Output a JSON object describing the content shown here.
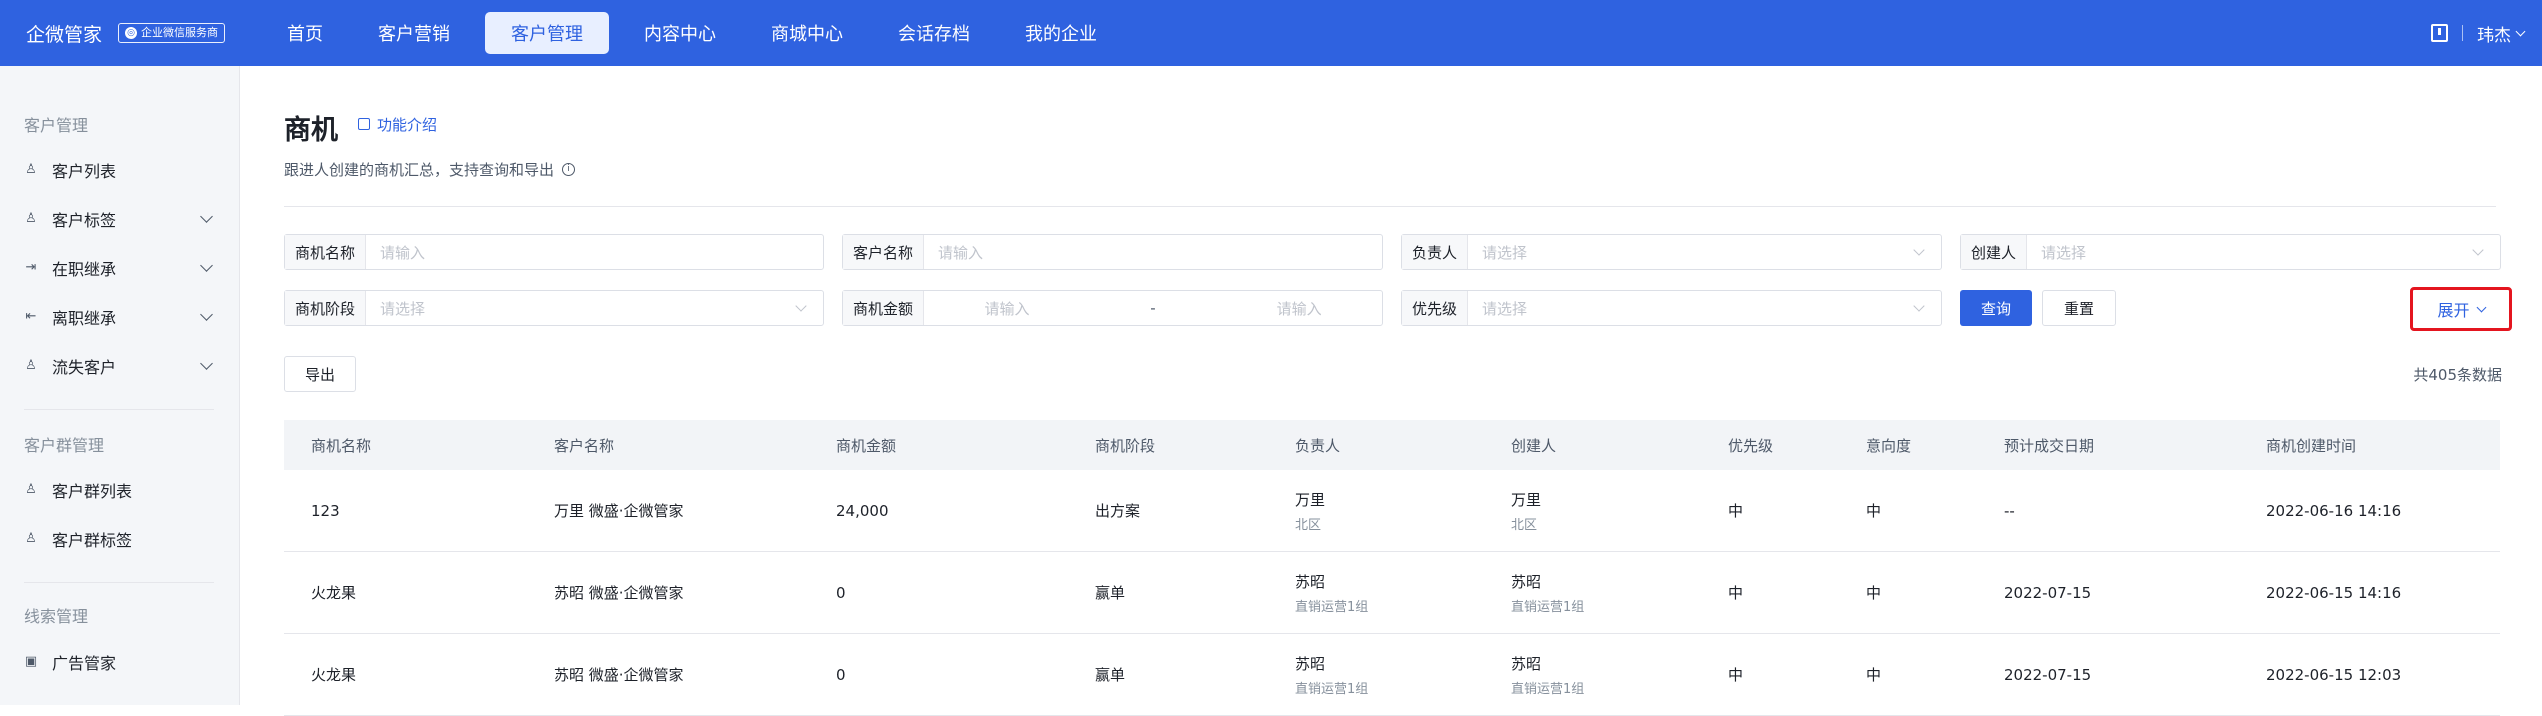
{
  "header": {
    "brand": "企微管家",
    "brand_badge": "企业微信服务商",
    "nav": [
      "首页",
      "客户营销",
      "客户管理",
      "内容中心",
      "商城中心",
      "会话存档",
      "我的企业"
    ],
    "active_nav": "客户管理",
    "user": "玮杰"
  },
  "sidebar": {
    "groups": [
      {
        "title": "客户管理",
        "items": [
          {
            "label": "客户列表",
            "icon": "user-icon",
            "expandable": false
          },
          {
            "label": "客户标签",
            "icon": "user-tag-icon",
            "expandable": true
          },
          {
            "label": "在职继承",
            "icon": "transfer-in-icon",
            "expandable": true
          },
          {
            "label": "离职继承",
            "icon": "transfer-out-icon",
            "expandable": true
          },
          {
            "label": "流失客户",
            "icon": "user-lost-icon",
            "expandable": true
          }
        ]
      },
      {
        "title": "客户群管理",
        "items": [
          {
            "label": "客户群列表",
            "icon": "group-icon",
            "expandable": false
          },
          {
            "label": "客户群标签",
            "icon": "group-tag-icon",
            "expandable": false
          }
        ]
      },
      {
        "title": "线索管理",
        "items": [
          {
            "label": "广告管家",
            "icon": "ad-icon",
            "expandable": false
          }
        ]
      }
    ]
  },
  "page": {
    "title": "商机",
    "intro_link": "功能介绍",
    "subtitle": "跟进人创建的商机汇总，支持查询和导出"
  },
  "filters": {
    "name": {
      "label": "商机名称",
      "placeholder": "请输入"
    },
    "customer": {
      "label": "客户名称",
      "placeholder": "请输入"
    },
    "owner": {
      "label": "负责人",
      "placeholder": "请选择"
    },
    "creator": {
      "label": "创建人",
      "placeholder": "请选择"
    },
    "stage": {
      "label": "商机阶段",
      "placeholder": "请选择"
    },
    "amount": {
      "label": "商机金额",
      "min_placeholder": "请输入",
      "separator": "-",
      "max_placeholder": "请输入"
    },
    "priority": {
      "label": "优先级",
      "placeholder": "请选择"
    },
    "query_button": "查询",
    "reset_button": "重置",
    "expand_button": "展开"
  },
  "actions": {
    "export_button": "导出",
    "total": "共405条数据"
  },
  "table": {
    "columns": [
      "商机名称",
      "客户名称",
      "商机金额",
      "商机阶段",
      "负责人",
      "创建人",
      "优先级",
      "意向度",
      "预计成交日期",
      "商机创建时间"
    ],
    "rows": [
      {
        "name": "123",
        "customer": "万里 微盛·企微管家",
        "amount": "24,000",
        "stage": "出方案",
        "owner": "万里",
        "owner_dept": "北区",
        "creator": "万里",
        "creator_dept": "北区",
        "priority": "中",
        "intent": "中",
        "expected_date": "--",
        "created_at": "2022-06-16 14:16"
      },
      {
        "name": "火龙果",
        "customer": "苏昭 微盛·企微管家",
        "amount": "0",
        "stage": "赢单",
        "owner": "苏昭",
        "owner_dept": "直销运营1组",
        "creator": "苏昭",
        "creator_dept": "直销运营1组",
        "priority": "中",
        "intent": "中",
        "expected_date": "2022-07-15",
        "created_at": "2022-06-15 14:16"
      },
      {
        "name": "火龙果",
        "customer": "苏昭 微盛·企微管家",
        "amount": "0",
        "stage": "赢单",
        "owner": "苏昭",
        "owner_dept": "直销运营1组",
        "creator": "苏昭",
        "creator_dept": "直销运营1组",
        "priority": "中",
        "intent": "中",
        "expected_date": "2022-07-15",
        "created_at": "2022-06-15 12:03"
      }
    ]
  },
  "colors": {
    "primary": "#2f62e0",
    "highlight_border": "#e4151f"
  }
}
